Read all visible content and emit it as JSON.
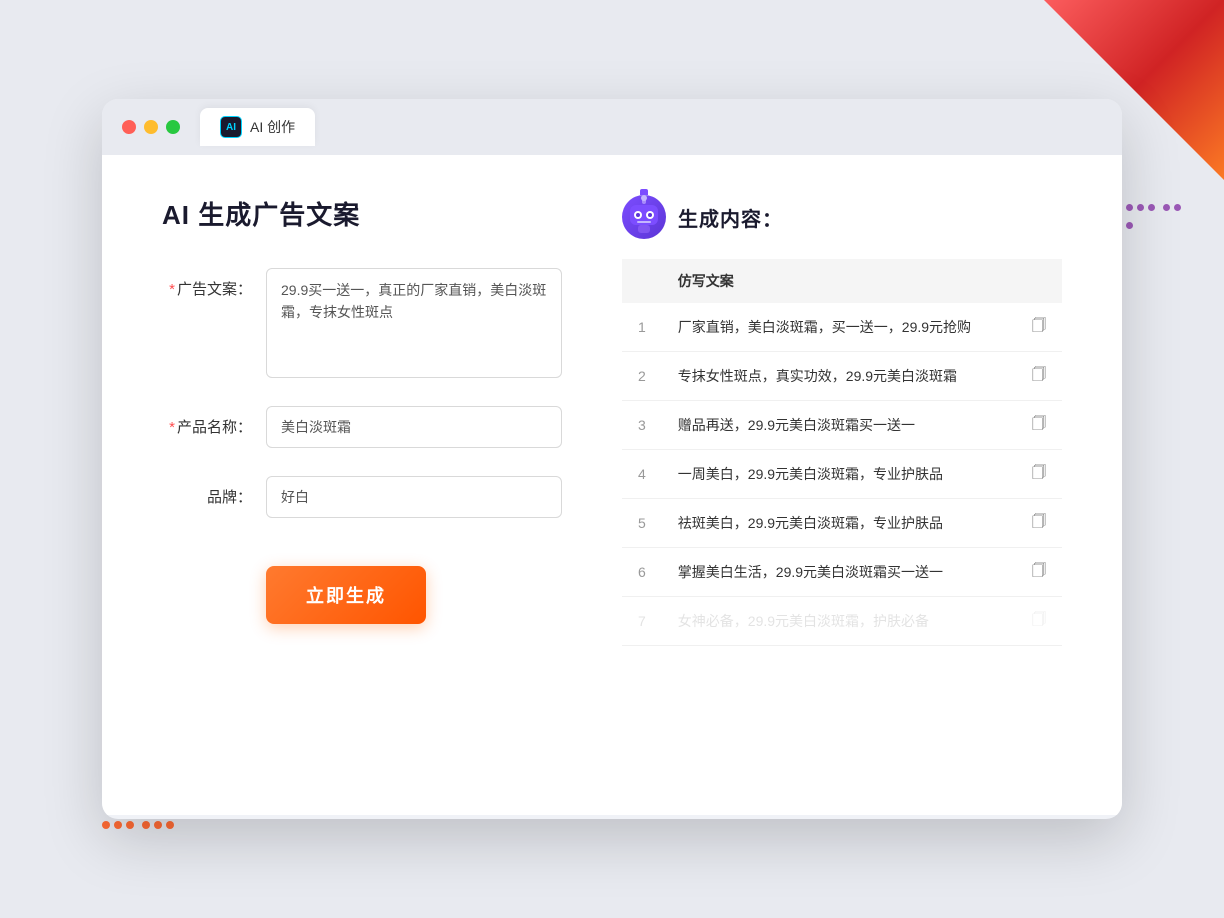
{
  "window": {
    "tab_label": "AI 创作"
  },
  "page": {
    "title": "AI 生成广告文案",
    "right_title": "生成内容："
  },
  "form": {
    "ad_copy_label": "广告文案：",
    "ad_copy_required": "*",
    "ad_copy_value": "29.9买一送一，真正的厂家直销，美白淡斑霜，专抹女性斑点",
    "product_name_label": "产品名称：",
    "product_name_required": "*",
    "product_name_value": "美白淡斑霜",
    "brand_label": "品牌：",
    "brand_value": "好白",
    "generate_btn_label": "立即生成"
  },
  "results": {
    "column_header": "仿写文案",
    "items": [
      {
        "num": "1",
        "text": "厂家直销，美白淡斑霜，买一送一，29.9元抢购",
        "faded": false
      },
      {
        "num": "2",
        "text": "专抹女性斑点，真实功效，29.9元美白淡斑霜",
        "faded": false
      },
      {
        "num": "3",
        "text": "赠品再送，29.9元美白淡斑霜买一送一",
        "faded": false
      },
      {
        "num": "4",
        "text": "一周美白，29.9元美白淡斑霜，专业护肤品",
        "faded": false
      },
      {
        "num": "5",
        "text": "祛斑美白，29.9元美白淡斑霜，专业护肤品",
        "faded": false
      },
      {
        "num": "6",
        "text": "掌握美白生活，29.9元美白淡斑霜买一送一",
        "faded": false
      },
      {
        "num": "7",
        "text": "女神必备，29.9元美白淡斑霜，护肤必备",
        "faded": true
      }
    ]
  }
}
